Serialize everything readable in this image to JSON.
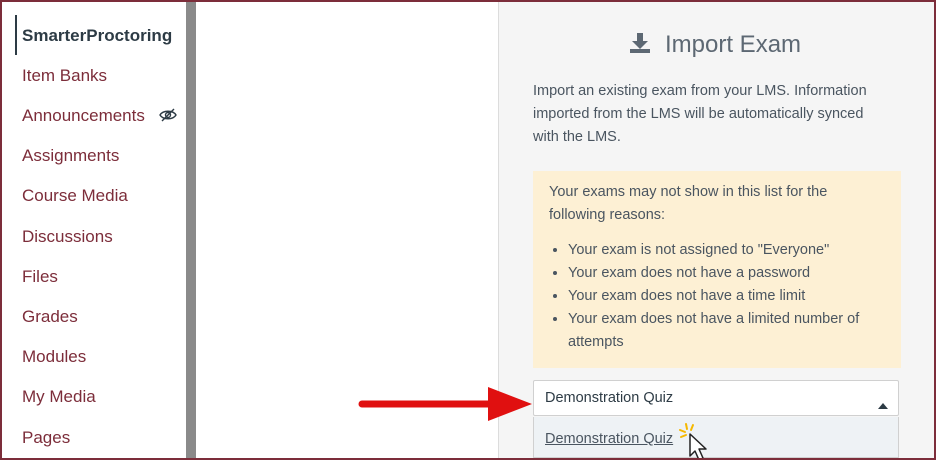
{
  "sidebar": {
    "active_item": "SmarterProctoring",
    "items": [
      {
        "label": "SmarterProctoring"
      },
      {
        "label": "Item Banks"
      },
      {
        "label": "Announcements",
        "icon": "eye-slash-icon"
      },
      {
        "label": "Assignments"
      },
      {
        "label": "Course Media"
      },
      {
        "label": "Discussions"
      },
      {
        "label": "Files"
      },
      {
        "label": "Grades"
      },
      {
        "label": "Modules"
      },
      {
        "label": "My Media"
      },
      {
        "label": "Pages"
      }
    ]
  },
  "import_panel": {
    "title": "Import Exam",
    "title_icon": "download-icon",
    "intro": "Import an existing exam from your LMS. Information imported from the LMS will be automatically synced with the LMS.",
    "notice": {
      "heading": "Your exams may not show in this list for the following reasons:",
      "reasons": [
        "Your exam is not assigned to \"Everyone\"",
        "Your exam does not have a password",
        "Your exam does not have a time limit",
        "Your exam does not have a limited number of attempts"
      ]
    },
    "exam_select": {
      "value": "Demonstration Quiz",
      "options": [
        "Demonstration Quiz"
      ]
    }
  },
  "colors": {
    "accent": "#7c2d3a",
    "notice_bg": "#fdf0d4",
    "annotation_arrow": "#e01010"
  }
}
